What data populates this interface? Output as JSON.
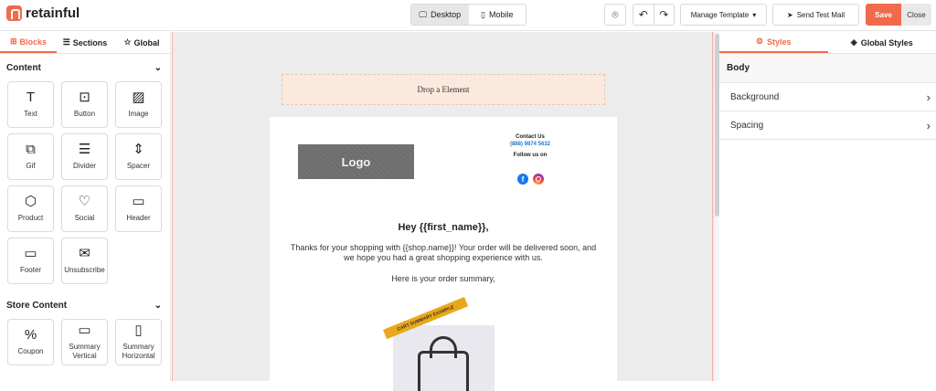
{
  "brand": {
    "name": "retainful",
    "accent": "#f26a4b"
  },
  "toolbar": {
    "device_options": [
      {
        "label": "Desktop",
        "icon": "desktop-icon",
        "active": true
      },
      {
        "label": "Mobile",
        "icon": "mobile-icon",
        "active": false
      }
    ],
    "manage_template": "Manage Template",
    "send_test": "Send Test Mail",
    "save": "Save",
    "close": "Close"
  },
  "left": {
    "tabs": [
      {
        "label": "Blocks",
        "icon": "blocks-icon"
      },
      {
        "label": "Sections",
        "icon": "sections-icon"
      },
      {
        "label": "Global",
        "icon": "star-icon"
      }
    ],
    "content_title": "Content",
    "content_blocks": [
      {
        "label": "Text",
        "icon": "T"
      },
      {
        "label": "Button",
        "icon": "⊡"
      },
      {
        "label": "Image",
        "icon": "▨"
      },
      {
        "label": "Gif",
        "icon": "⧉"
      },
      {
        "label": "Divider",
        "icon": "☰"
      },
      {
        "label": "Spacer",
        "icon": "⇕"
      },
      {
        "label": "Product",
        "icon": "⬡"
      },
      {
        "label": "Social",
        "icon": "♡"
      },
      {
        "label": "Header",
        "icon": "▭"
      },
      {
        "label": "Footer",
        "icon": "▭"
      },
      {
        "label": "Unsubscribe",
        "icon": "✉"
      }
    ],
    "store_title": "Store Content",
    "store_blocks": [
      {
        "label": "Coupon",
        "icon": "%"
      },
      {
        "label": "Summary Vertical",
        "icon": "▭"
      },
      {
        "label": "Summary Horizontal",
        "icon": "▯"
      }
    ]
  },
  "canvas": {
    "drop_text": "Drop a Element",
    "logo_text": "Logo",
    "contact_title": "Contact Us",
    "contact_phone": "(888) 9874 5632",
    "follow_text": "Follow us on",
    "greeting": "Hey {{first_name}},",
    "message": "Thanks for your shopping with {{shop.name}}! Your order will be delivered soon, and we hope you had a great shopping experience with us.",
    "summary_text": "Here is your order summary,",
    "ribbon_text": "CART SUMMARY EXAMPLE"
  },
  "right": {
    "tabs": [
      {
        "label": "Styles",
        "icon": "gear-icon"
      },
      {
        "label": "Global Styles",
        "icon": "paint-icon"
      }
    ],
    "section_title": "Body",
    "items": [
      {
        "label": "Background"
      },
      {
        "label": "Spacing"
      }
    ]
  }
}
